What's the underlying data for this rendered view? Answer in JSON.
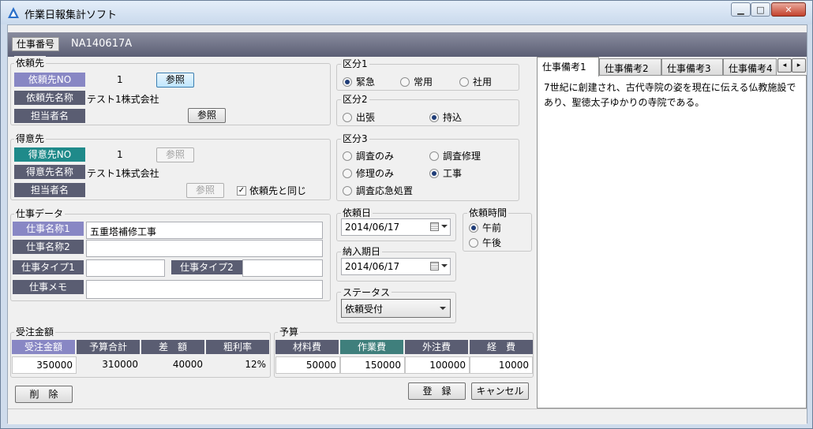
{
  "window": {
    "title": "作業日報集計ソフト",
    "minimize": "▁",
    "maximize": "□",
    "close": "✕"
  },
  "header": {
    "job_label": "仕事番号",
    "job_no": "NA140617A"
  },
  "client": {
    "title": "依頼先",
    "no_label": "依頼先NO",
    "no_value": "1",
    "ref1": "参照",
    "name_label": "依頼先名称",
    "name_value": "テスト1株式会社",
    "person_label": "担当者名",
    "ref2": "参照"
  },
  "customer": {
    "title": "得意先",
    "no_label": "得意先NO",
    "no_value": "1",
    "ref1": "参照",
    "name_label": "得意先名称",
    "name_value": "テスト1株式会社",
    "person_label": "担当者名",
    "ref2": "参照",
    "same_label": "依頼先と同じ",
    "same_checked": "✓"
  },
  "jobdata": {
    "title": "仕事データ",
    "name1_label": "仕事名称1",
    "name1_value": "五重塔補修工事",
    "name2_label": "仕事名称2",
    "type1_label": "仕事タイプ1",
    "type2_label": "仕事タイプ2",
    "memo_label": "仕事メモ"
  },
  "kubun1": {
    "title": "区分1",
    "opt1": "緊急",
    "opt2": "常用",
    "opt3": "社用"
  },
  "kubun2": {
    "title": "区分2",
    "opt1": "出張",
    "opt2": "持込"
  },
  "kubun3": {
    "title": "区分3",
    "opt1": "調査のみ",
    "opt2": "調査修理",
    "opt3": "修理のみ",
    "opt4": "工事",
    "opt5": "調査応急処置"
  },
  "request_date": {
    "title": "依頼日",
    "value": "2014/06/17"
  },
  "due_date": {
    "title": "納入期日",
    "value": "2014/06/17"
  },
  "request_time": {
    "title": "依頼時間",
    "am": "午前",
    "pm": "午後"
  },
  "status": {
    "title": "ステータス",
    "value": "依頼受付"
  },
  "order": {
    "title": "受注金額",
    "headers": [
      "受注金額",
      "予算合計",
      "差　額",
      "粗利率"
    ],
    "values": [
      "350000",
      "310000",
      "40000",
      "12%"
    ]
  },
  "budget": {
    "title": "予算",
    "headers": [
      "材料費",
      "作業費",
      "外注費",
      "経　費"
    ],
    "values": [
      "50000",
      "150000",
      "100000",
      "10000"
    ]
  },
  "buttons": {
    "delete": "削　除",
    "register": "登　録",
    "cancel": "キャンセル"
  },
  "tabs": [
    "仕事備考1",
    "仕事備考2",
    "仕事備考3",
    "仕事備考4"
  ],
  "tab_scroll": {
    "left": "◂",
    "right": "▸"
  },
  "memo_text": "7世紀に創建され、古代寺院の姿を現在に伝える仏教施設であり、聖徳太子ゆかりの寺院である。"
}
